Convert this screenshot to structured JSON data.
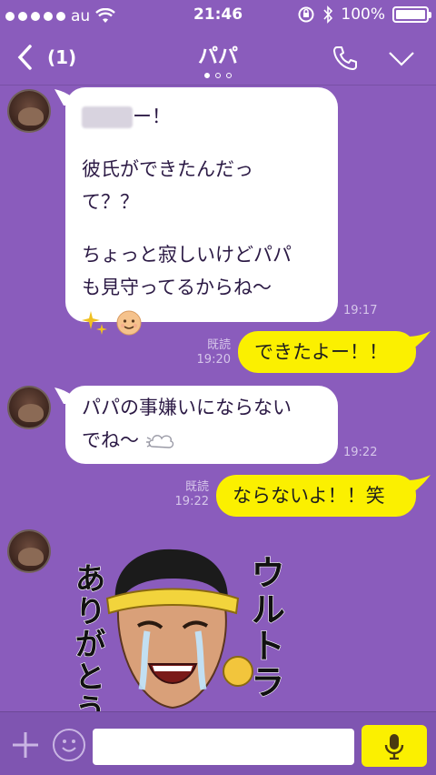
{
  "status": {
    "carrier": "au",
    "time": "21:46",
    "battery": "100%"
  },
  "header": {
    "back_count": "(1)",
    "title": "パパ"
  },
  "messages": {
    "m1": {
      "line1_suffix": "ー！",
      "line2": "彼氏ができたんだっ",
      "line3": "て？？",
      "line4": "ちょっと寂しいけどパパ",
      "line5": "も見守ってるからね〜",
      "time": "19:17"
    },
    "m2": {
      "text": "できたよー！！",
      "read": "既読",
      "time": "19:20"
    },
    "m3": {
      "line1": "パパの事嫌いにならない",
      "line2": "でね〜",
      "time": "19:22"
    },
    "m4": {
      "text": "ならないよ！！笑",
      "read": "既読",
      "time": "19:22"
    },
    "sticker": {
      "text_right": "ウルトラ",
      "text_left": "ありがとう"
    }
  },
  "input": {
    "placeholder": ""
  },
  "colors": {
    "background": "#8a5cbc",
    "bubble_out": "#fbf000",
    "bubble_in": "#ffffff"
  }
}
